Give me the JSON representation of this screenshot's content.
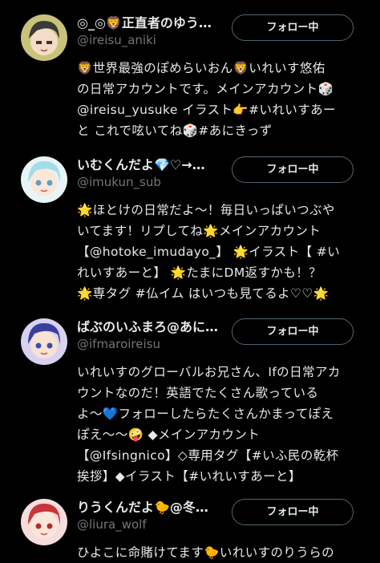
{
  "users": [
    {
      "display_name": "◎_◎🦁正直者のゆう…",
      "handle": "@ireisu_aniki",
      "follow_label": "フォロー中",
      "bio_lines": [
        "🦁世界最強のぽめらいおん🦁いれいす悠佑",
        "の日常アカウントです。メインアカウント🎲",
        "@ireisu_yusuke イラスト👉#いれいすあー",
        "と これで呟いてね🎲#あにきっず"
      ]
    },
    {
      "display_name": "いむくんだよ💎♡→…",
      "handle": "@imukun_sub",
      "follow_label": "フォロー中",
      "bio_lines": [
        "🌟ほとけの日常だよ～！毎日いっぱいつぶや",
        "いてます！リプしてね🌟メインアカウント",
        "【@hotoke_imudayo_】 🌟イラスト【 #い",
        "れいすあーと】 🌟たまにDM返すかも！？",
        "🌟専タグ #仏イム はいつも見てるよ♡♡🌟"
      ]
    },
    {
      "display_name": "ばぶのいふまろ@あに…",
      "handle": "@ifmaroireisu",
      "follow_label": "フォロー中",
      "bio_lines": [
        "いれいすのグローバルお兄さん、Ifの日常アカ",
        "ウントなのだ！英語でたくさん歌っている",
        "よ〜💙フォローしたらたくさんかまってぽえ",
        "ぽえ〜〜🤪 ◆メインアカウント",
        "【@Ifsingnico】◇専用タグ【#いふ民の乾杯",
        "挨拶】◆イラスト【#いれいすあーと】"
      ]
    },
    {
      "display_name": "りうくんだよ🐤@冬…",
      "handle": "@liura_wolf",
      "follow_label": "フォロー中",
      "bio_lines": [
        "ひよこに命賭けてます🐤いれいすのりうらの"
      ]
    }
  ]
}
